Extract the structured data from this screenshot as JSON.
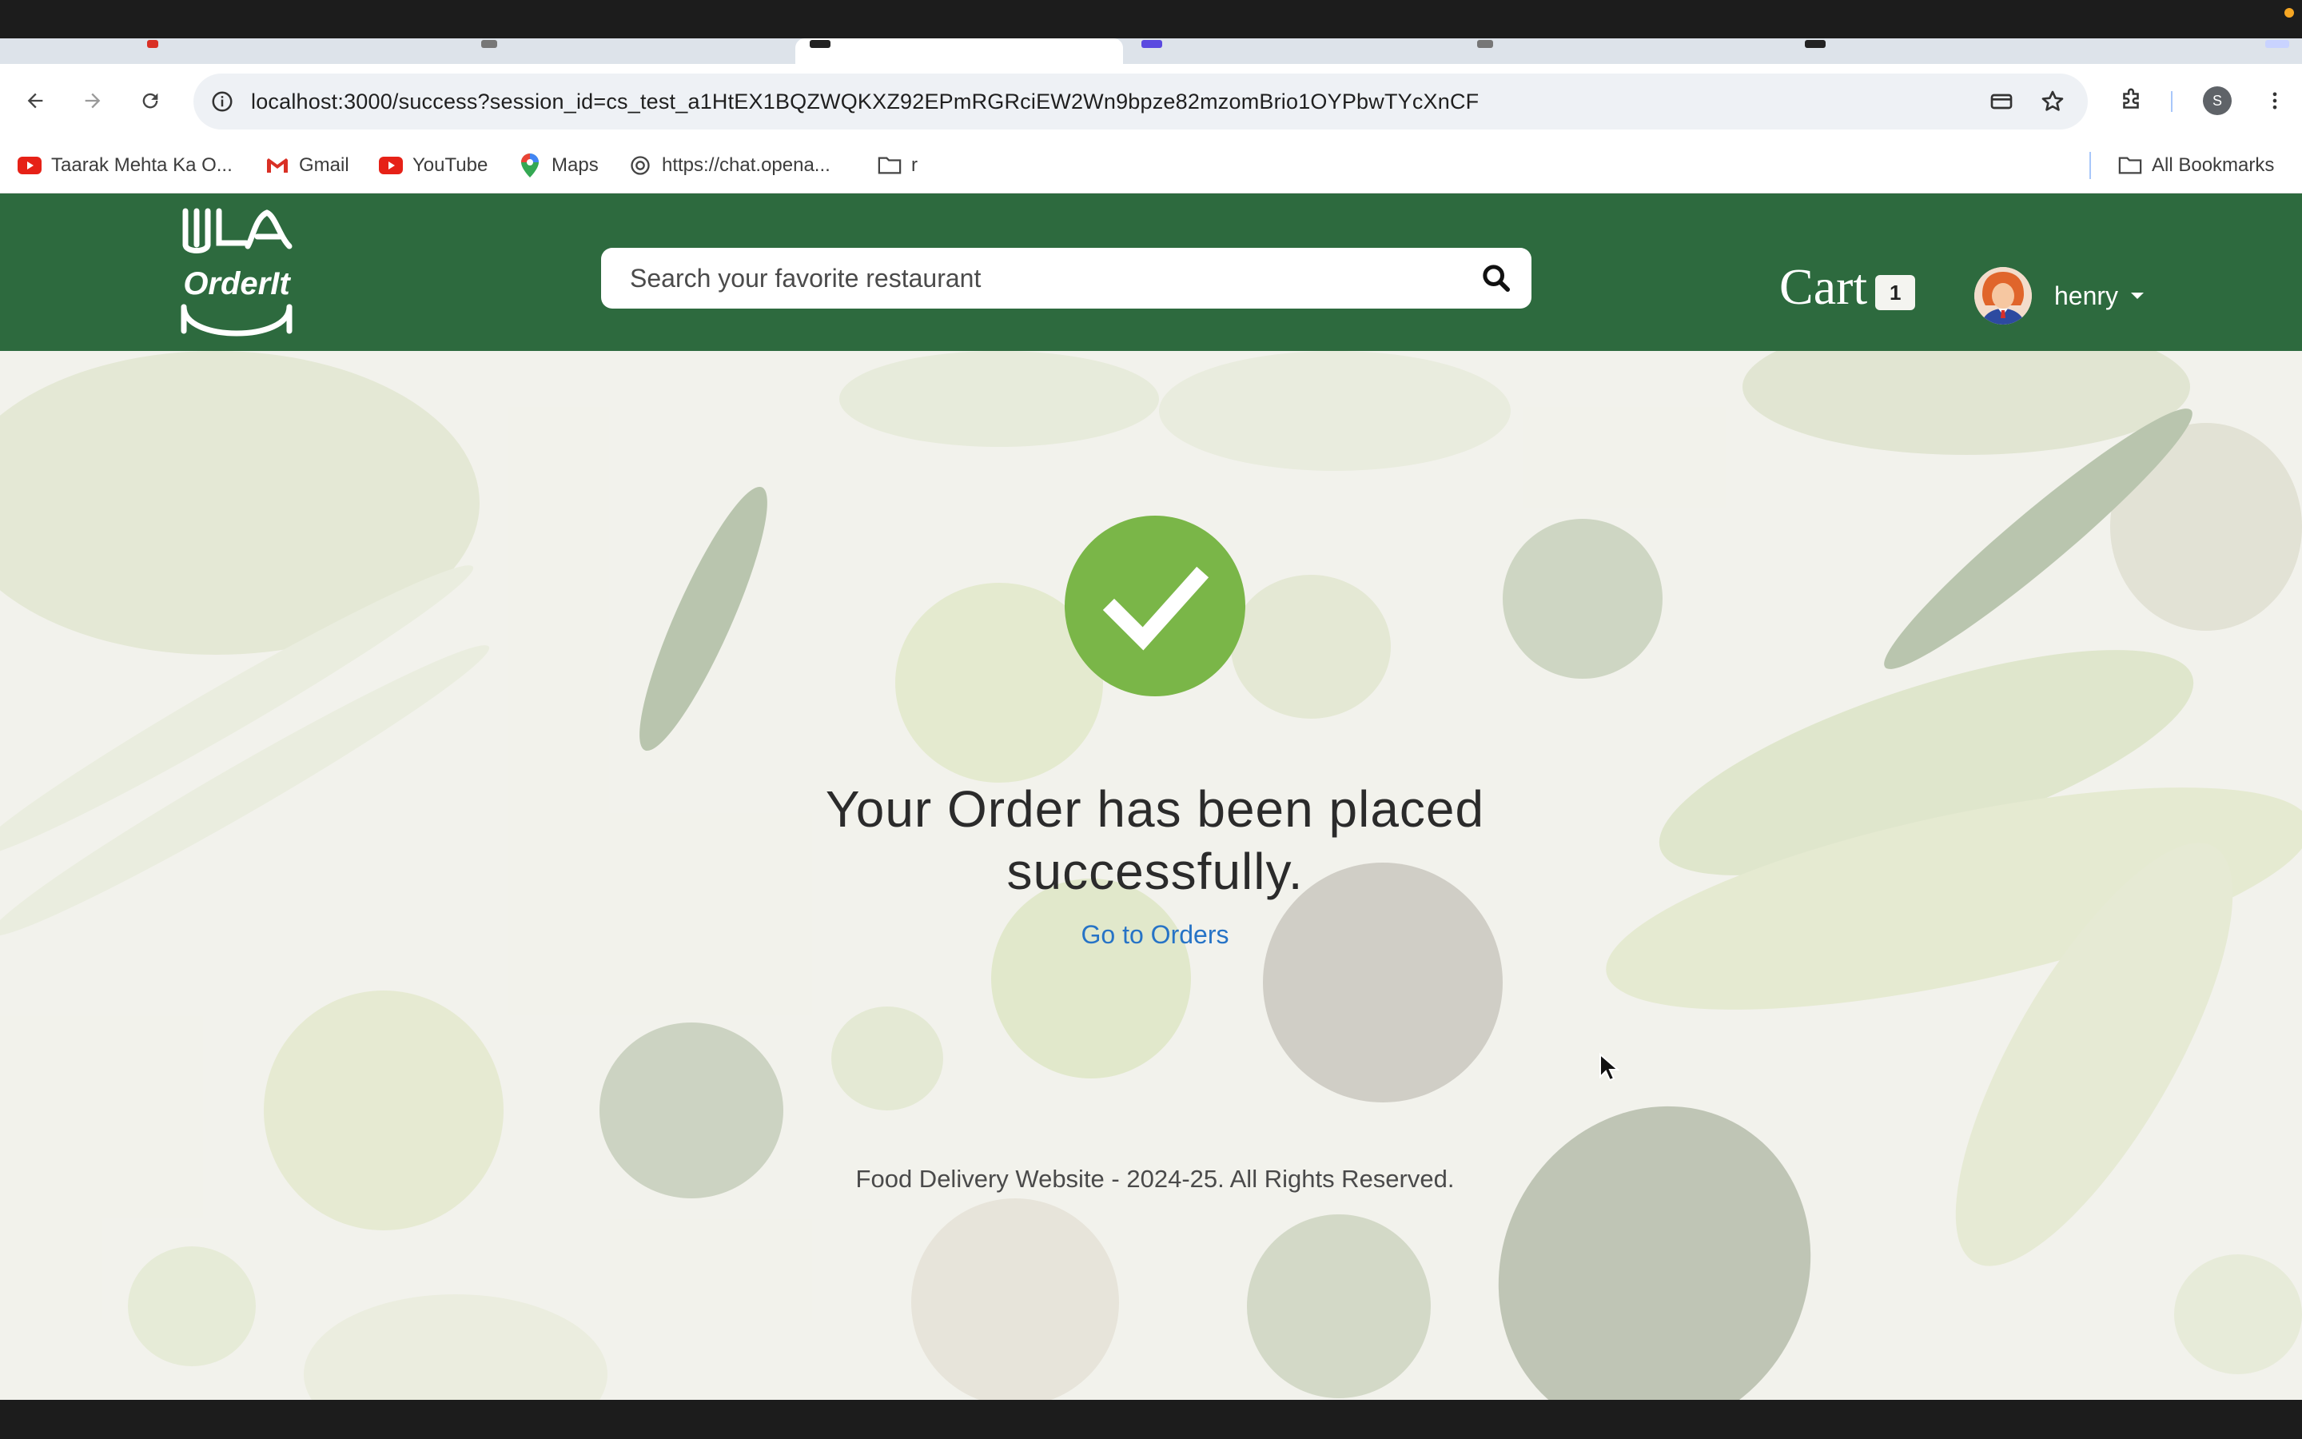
{
  "browser": {
    "url": "localhost:3000/success?session_id=cs_test_a1HtEX1BQZWQKXZ92EPmRGRciEW2Wn9bpze82mzomBrio1OYPbwTYcXnCF",
    "profile_initial": "S",
    "bookmarks": [
      {
        "label": "Taarak Mehta Ka O...",
        "icon": "youtube-icon"
      },
      {
        "label": "Gmail",
        "icon": "gmail-icon"
      },
      {
        "label": "YouTube",
        "icon": "youtube-icon"
      },
      {
        "label": "Maps",
        "icon": "maps-icon"
      },
      {
        "label": "https://chat.opena...",
        "icon": "chatgpt-icon"
      },
      {
        "label": "r",
        "icon": "folder-icon"
      }
    ],
    "all_bookmarks_label": "All Bookmarks"
  },
  "site": {
    "logo_text": "OrderIt",
    "search_placeholder": "Search your favorite restaurant",
    "cart_label": "Cart",
    "cart_count": "1",
    "username": "henry"
  },
  "success": {
    "message": "Your Order has been placed successfully.",
    "link_label": "Go to Orders"
  },
  "footer": {
    "text": "Food Delivery Website - 2024-25. All Rights Reserved."
  },
  "colors": {
    "header_bg": "#2d6a3e",
    "check_bg": "#7ab648",
    "link": "#2673c6"
  }
}
